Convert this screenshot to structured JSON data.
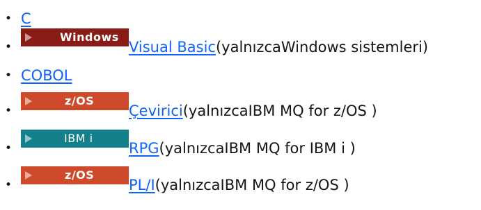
{
  "colors": {
    "link": "#0f62fe",
    "text": "#161616",
    "windows_badge": "#8a1c16",
    "zos_badge": "#cf4a2a",
    "ibmi_badge": "#14808b"
  },
  "items": [
    {
      "link": "C",
      "rest": ""
    },
    {
      "badge": {
        "label": "Windows",
        "icon": "arrow-right-icon",
        "color": "#8a1c16"
      },
      "link": "Visual Basic",
      "rest": " (yalnızcaWindows sistemleri)"
    },
    {
      "link": "COBOL",
      "rest": ""
    },
    {
      "badge": {
        "label": "z/OS",
        "icon": "arrow-right-icon",
        "color": "#cf4a2a"
      },
      "link": "Çevirici",
      "rest": " (yalnızcaIBM MQ for z/OS )"
    },
    {
      "badge": {
        "label": "IBM i",
        "icon": "arrow-right-icon",
        "color": "#14808b"
      },
      "link": "RPG",
      "rest": " (yalnızcaIBM MQ for IBM i )"
    },
    {
      "badge": {
        "label": "z/OS",
        "icon": "arrow-right-icon",
        "color": "#cf4a2a"
      },
      "link": "PL/I",
      "rest": " (yalnızcaIBM MQ for z/OS )"
    }
  ]
}
